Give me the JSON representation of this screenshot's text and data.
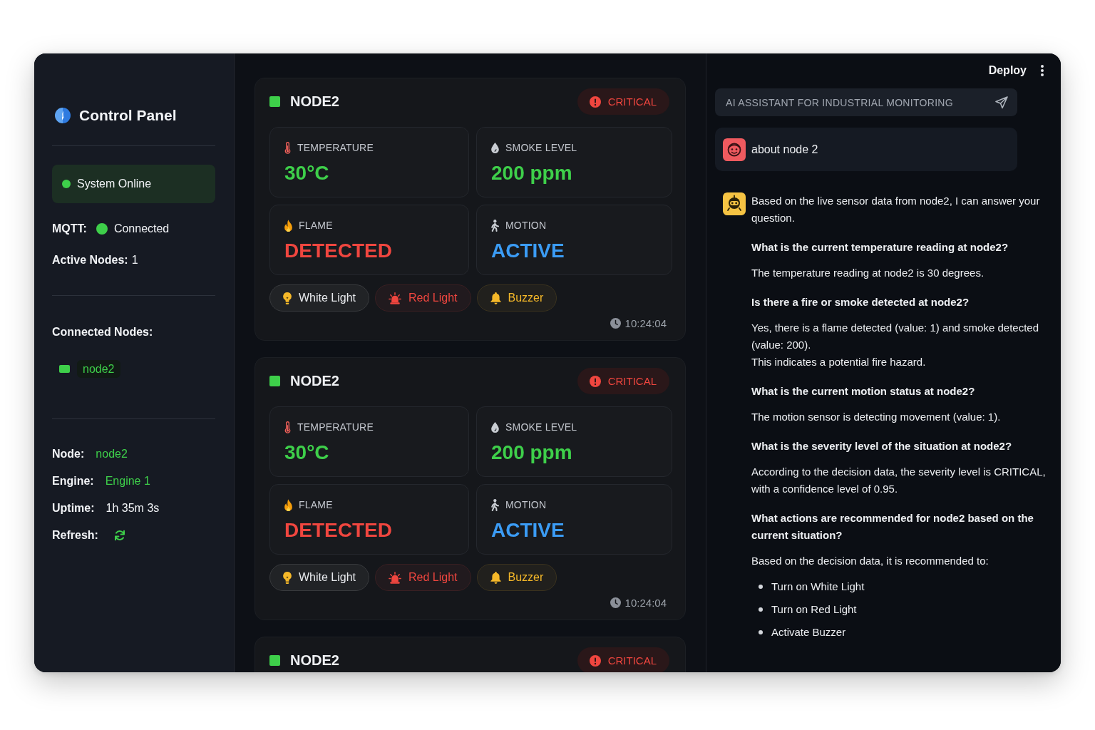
{
  "sidebar": {
    "title": "Control Panel",
    "system_status": {
      "label": "System Online",
      "online": true
    },
    "mqtt": {
      "label": "MQTT:",
      "value": "Connected",
      "connected": true
    },
    "active_nodes": {
      "label": "Active Nodes:",
      "value": "1"
    },
    "connected_nodes": {
      "heading": "Connected Nodes:",
      "items": [
        {
          "label": "node2",
          "color": "#3ecf4a"
        }
      ]
    },
    "details": [
      {
        "kind": "highlight",
        "label": "Node:",
        "value": "node2"
      },
      {
        "kind": "highlight",
        "label": "Engine:",
        "value": "Engine 1"
      },
      {
        "kind": "plain",
        "label": "Uptime:",
        "value": "1h 35m 3s"
      },
      {
        "kind": "refresh",
        "label": "Refresh:"
      }
    ]
  },
  "nodes": [
    {
      "name": "NODE2",
      "color": "#3ecf4a",
      "severity": "CRITICAL",
      "sensors": [
        {
          "kind": "temperature",
          "label": "TEMPERATURE",
          "value": "30°C",
          "color": "#3ecf4a"
        },
        {
          "kind": "smoke",
          "label": "SMOKE LEVEL",
          "value": "200 ppm",
          "color": "#3ecf4a"
        },
        {
          "kind": "flame",
          "label": "FLAME",
          "value": "DETECTED",
          "color": "#f0463f"
        },
        {
          "kind": "motion",
          "label": "MOTION",
          "value": "ACTIVE",
          "color": "#3b9cf5"
        }
      ],
      "actuators": [
        {
          "kind": "bulb",
          "label": "White Light",
          "color": "#e8eaed"
        },
        {
          "kind": "siren",
          "label": "Red Light",
          "color": "#f0463f"
        },
        {
          "kind": "bell",
          "label": "Buzzer",
          "color": "#f5b829"
        }
      ],
      "time": "10:24:04"
    },
    {
      "name": "NODE2",
      "color": "#3ecf4a",
      "severity": "CRITICAL",
      "sensors": [
        {
          "kind": "temperature",
          "label": "TEMPERATURE",
          "value": "30°C",
          "color": "#3ecf4a"
        },
        {
          "kind": "smoke",
          "label": "SMOKE LEVEL",
          "value": "200 ppm",
          "color": "#3ecf4a"
        },
        {
          "kind": "flame",
          "label": "FLAME",
          "value": "DETECTED",
          "color": "#f0463f"
        },
        {
          "kind": "motion",
          "label": "MOTION",
          "value": "ACTIVE",
          "color": "#3b9cf5"
        }
      ],
      "actuators": [
        {
          "kind": "bulb",
          "label": "White Light",
          "color": "#e8eaed"
        },
        {
          "kind": "siren",
          "label": "Red Light",
          "color": "#f0463f"
        },
        {
          "kind": "bell",
          "label": "Buzzer",
          "color": "#f5b829"
        }
      ],
      "time": "10:24:04"
    },
    {
      "name": "NODE2",
      "color": "#3ecf4a",
      "severity": "CRITICAL"
    }
  ],
  "toolbar": {
    "deploy": "Deploy"
  },
  "chat": {
    "input": {
      "placeholder": "AI ASSISTANT FOR INDUSTRIAL MONITORING"
    },
    "messages": [
      {
        "kind": "user",
        "text": "about node 2"
      },
      {
        "kind": "assistant",
        "blocks": [
          {
            "kind": "text",
            "lines": [
              "Based on the live sensor data from node2, I can answer your question."
            ]
          },
          {
            "kind": "question",
            "text": "What is the current temperature reading at node2?"
          },
          {
            "kind": "text",
            "lines": [
              "The temperature reading at node2 is 30 degrees."
            ]
          },
          {
            "kind": "question",
            "text": "Is there a fire or smoke detected at node2?"
          },
          {
            "kind": "text",
            "lines": [
              "Yes, there is a flame detected (value: 1) and smoke detected (value: 200).",
              "This indicates a potential fire hazard."
            ]
          },
          {
            "kind": "question",
            "text": "What is the current motion status at node2?"
          },
          {
            "kind": "text",
            "lines": [
              "The motion sensor is detecting movement (value: 1)."
            ]
          },
          {
            "kind": "question",
            "text": "What is the severity level of the situation at node2?"
          },
          {
            "kind": "text",
            "lines": [
              "According to the decision data, the severity level is CRITICAL, with a confidence level of 0.95."
            ]
          },
          {
            "kind": "question",
            "text": "What actions are recommended for node2 based on the current situation?"
          },
          {
            "kind": "text",
            "lines": [
              "Based on the decision data, it is recommended to:"
            ]
          },
          {
            "kind": "list",
            "items": [
              "Turn on White Light",
              "Turn on Red Light",
              "Activate Buzzer"
            ]
          }
        ]
      }
    ]
  }
}
